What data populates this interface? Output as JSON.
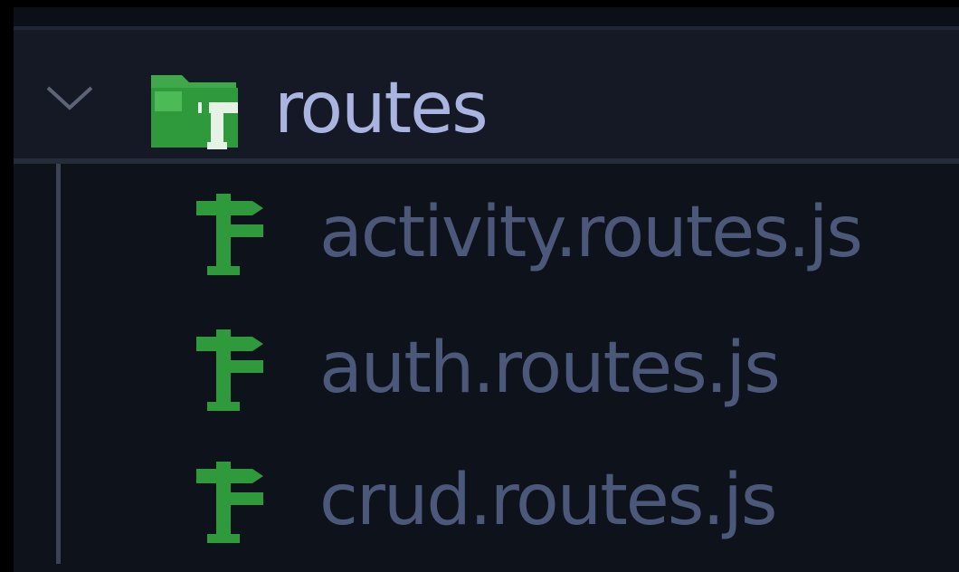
{
  "explorer": {
    "folder": {
      "name": "routes",
      "expanded": true,
      "icon": "folder-routes-icon",
      "icon_color": "#2f9a3c",
      "label_color": "#aab4e0"
    },
    "files": [
      {
        "name": "activity.routes.js",
        "icon": "routes-file-icon"
      },
      {
        "name": "auth.routes.js",
        "icon": "routes-file-icon"
      },
      {
        "name": "crud.routes.js",
        "icon": "routes-file-icon"
      }
    ],
    "colors": {
      "background": "#0e121b",
      "folder_row_background": "#141925",
      "file_label": "#4b587a",
      "icon_green": "#2f9a3c",
      "indent_guide": "#3b4252"
    }
  }
}
